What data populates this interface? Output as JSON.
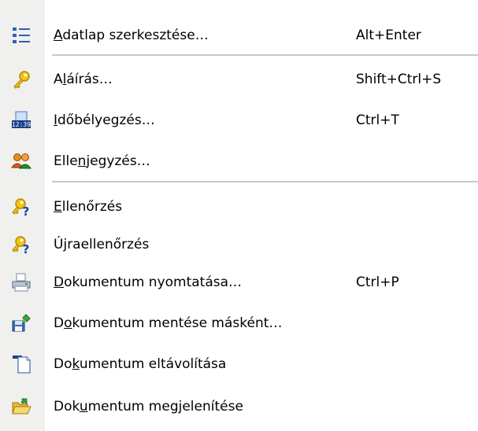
{
  "menu": {
    "items": [
      {
        "pre": "",
        "acc": "A",
        "post": "datlap szerkesztése…",
        "shortcut": "Alt+Enter",
        "icon": "list-icon"
      },
      {
        "pre": "A",
        "acc": "l",
        "post": "áírás…",
        "shortcut": "Shift+Ctrl+S",
        "icon": "key-icon"
      },
      {
        "pre": "",
        "acc": "I",
        "post": "dőbélyegzés…",
        "shortcut": "Ctrl+T",
        "icon": "timestamp-icon"
      },
      {
        "pre": "Elle",
        "acc": "n",
        "post": "jegyzés…",
        "shortcut": "",
        "icon": "users-icon"
      },
      {
        "pre": "",
        "acc": "E",
        "post": "llenőrzés",
        "shortcut": "",
        "icon": "key-question-icon"
      },
      {
        "pre": "Ú",
        "acc": "j",
        "post": "raellenőrzés",
        "shortcut": "",
        "icon": "key-question-icon"
      },
      {
        "pre": "",
        "acc": "D",
        "post": "okumentum nyomtatása…",
        "shortcut": "Ctrl+P",
        "icon": "printer-icon"
      },
      {
        "pre": "D",
        "acc": "o",
        "post": "kumentum mentése másként…",
        "shortcut": "",
        "icon": "save-as-icon"
      },
      {
        "pre": "Do",
        "acc": "k",
        "post": "umentum eltávolítása",
        "shortcut": "",
        "icon": "document-remove-icon"
      },
      {
        "pre": "Dok",
        "acc": "u",
        "post": "mentum megjelenítése",
        "shortcut": "",
        "icon": "folder-open-icon"
      }
    ]
  },
  "colors": {
    "gutter": "#f0f0ee",
    "separator": "#c8c8c8",
    "key": "#e8b000",
    "question": "#1a3fb0"
  }
}
